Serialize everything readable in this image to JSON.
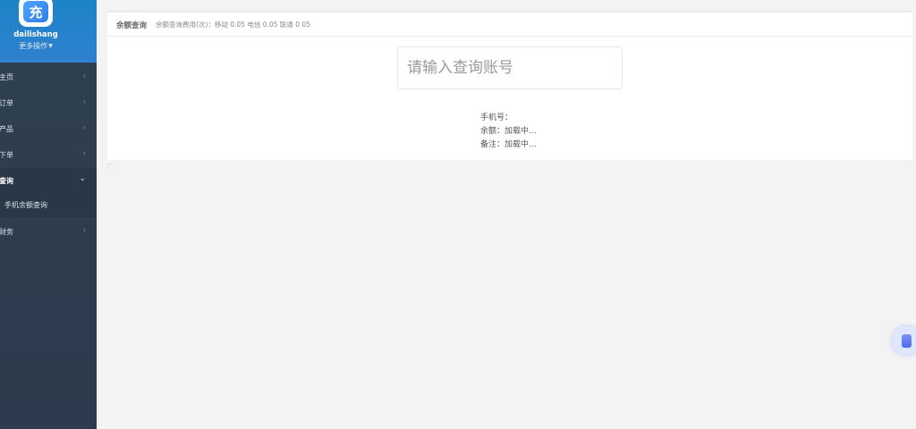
{
  "sidebar": {
    "logo_char": "充",
    "username": "dailishang",
    "more_ops": "更多操作",
    "items": [
      {
        "label": "主页",
        "arrow": "‹"
      },
      {
        "label": "订单",
        "arrow": "‹"
      },
      {
        "label": "产品",
        "arrow": "‹"
      },
      {
        "label": "下单",
        "arrow": "‹"
      },
      {
        "label": "查询",
        "arrow": "⌄",
        "active": true,
        "children": [
          {
            "label": "手机余额查询"
          }
        ]
      },
      {
        "label": "财务",
        "arrow": "‹"
      }
    ]
  },
  "main": {
    "title": "余额查询",
    "fee_info": "余额查询费用(次)：移动 0.05 电信 0.05 联通 0.05",
    "search": {
      "placeholder": "请输入查询账号",
      "value": ""
    },
    "result": {
      "phone_label": "手机号：",
      "phone_value": "",
      "balance_label": "余额：",
      "balance_value": "加载中...",
      "remark_label": "备注：",
      "remark_value": "加载中..."
    }
  },
  "colors": {
    "sidebar_bg": "#2f4050",
    "profile_bg": "#1c84c6",
    "page_bg": "#f3f3f4"
  }
}
